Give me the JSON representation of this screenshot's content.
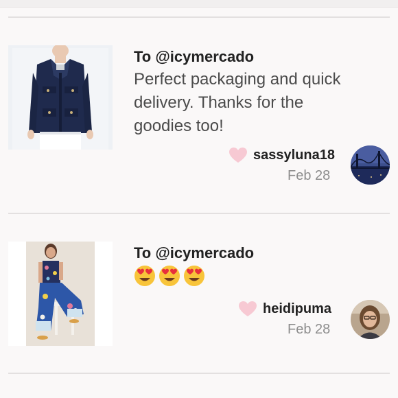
{
  "reviews": [
    {
      "to": "To @icymercado",
      "message_lines": [
        "Perfect packaging and quick",
        "delivery. Thanks for the",
        "goodies too!"
      ],
      "username": "sassyluna18",
      "date": "Feb 28",
      "product_image": "navy-jacket-photo",
      "avatar_image": "bridge-photo-avatar",
      "liked_icon": "heart-icon"
    },
    {
      "to": "To @icymercado",
      "emojis": [
        "heart-eyes-emoji",
        "heart-eyes-emoji",
        "heart-eyes-emoji"
      ],
      "username": "heidipuma",
      "date": "Feb 28",
      "product_image": "floral-outfit-photo",
      "avatar_image": "woman-photo-avatar",
      "liked_icon": "heart-icon"
    }
  ],
  "colors": {
    "heart": "#f7c9d3",
    "divider": "#e3e0e0",
    "emoji_face": "#f8c43a",
    "emoji_eyes": "#e8303c"
  }
}
